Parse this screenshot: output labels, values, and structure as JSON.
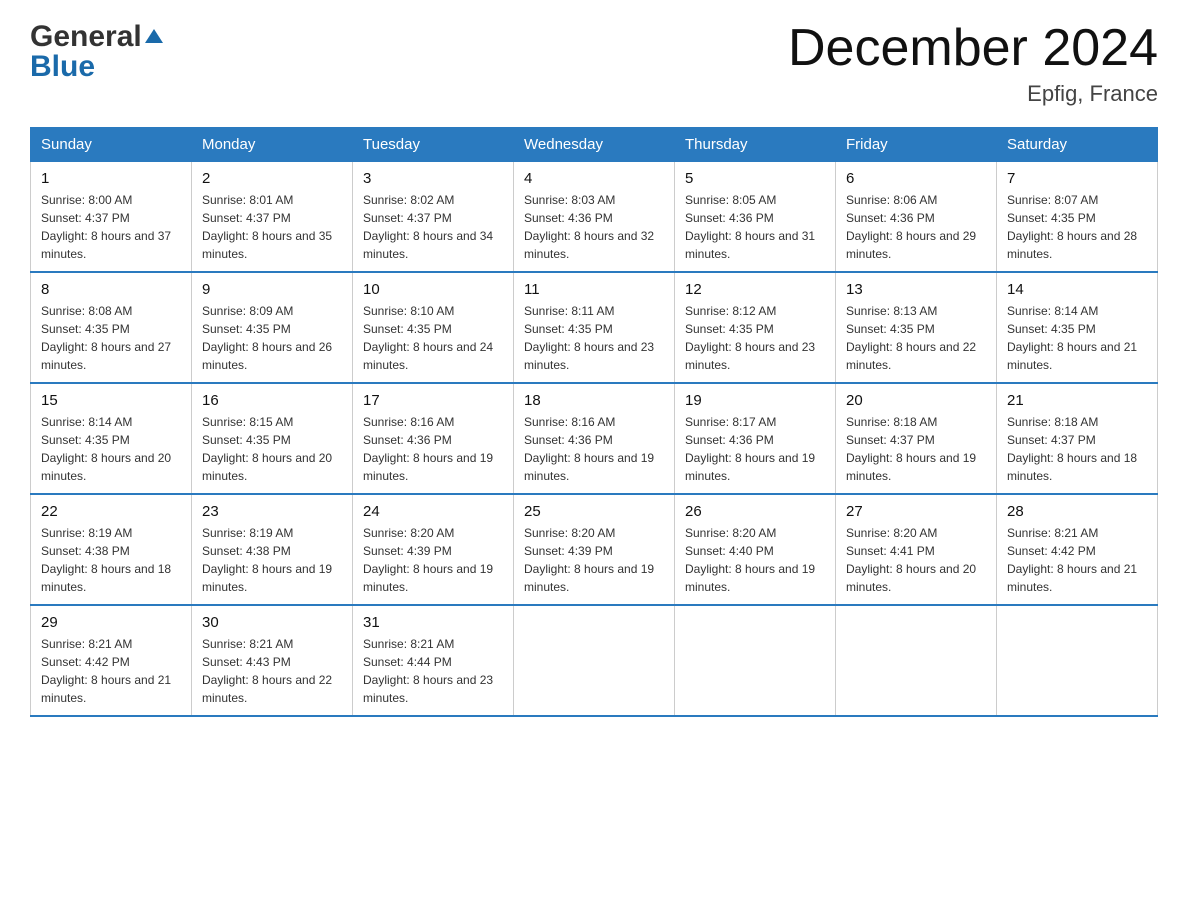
{
  "header": {
    "logo_line1": "General",
    "logo_line2": "Blue",
    "title": "December 2024",
    "subtitle": "Epfig, France"
  },
  "days_of_week": [
    "Sunday",
    "Monday",
    "Tuesday",
    "Wednesday",
    "Thursday",
    "Friday",
    "Saturday"
  ],
  "weeks": [
    [
      {
        "day": "1",
        "sunrise": "8:00 AM",
        "sunset": "4:37 PM",
        "daylight": "8 hours and 37 minutes."
      },
      {
        "day": "2",
        "sunrise": "8:01 AM",
        "sunset": "4:37 PM",
        "daylight": "8 hours and 35 minutes."
      },
      {
        "day": "3",
        "sunrise": "8:02 AM",
        "sunset": "4:37 PM",
        "daylight": "8 hours and 34 minutes."
      },
      {
        "day": "4",
        "sunrise": "8:03 AM",
        "sunset": "4:36 PM",
        "daylight": "8 hours and 32 minutes."
      },
      {
        "day": "5",
        "sunrise": "8:05 AM",
        "sunset": "4:36 PM",
        "daylight": "8 hours and 31 minutes."
      },
      {
        "day": "6",
        "sunrise": "8:06 AM",
        "sunset": "4:36 PM",
        "daylight": "8 hours and 29 minutes."
      },
      {
        "day": "7",
        "sunrise": "8:07 AM",
        "sunset": "4:35 PM",
        "daylight": "8 hours and 28 minutes."
      }
    ],
    [
      {
        "day": "8",
        "sunrise": "8:08 AM",
        "sunset": "4:35 PM",
        "daylight": "8 hours and 27 minutes."
      },
      {
        "day": "9",
        "sunrise": "8:09 AM",
        "sunset": "4:35 PM",
        "daylight": "8 hours and 26 minutes."
      },
      {
        "day": "10",
        "sunrise": "8:10 AM",
        "sunset": "4:35 PM",
        "daylight": "8 hours and 24 minutes."
      },
      {
        "day": "11",
        "sunrise": "8:11 AM",
        "sunset": "4:35 PM",
        "daylight": "8 hours and 23 minutes."
      },
      {
        "day": "12",
        "sunrise": "8:12 AM",
        "sunset": "4:35 PM",
        "daylight": "8 hours and 23 minutes."
      },
      {
        "day": "13",
        "sunrise": "8:13 AM",
        "sunset": "4:35 PM",
        "daylight": "8 hours and 22 minutes."
      },
      {
        "day": "14",
        "sunrise": "8:14 AM",
        "sunset": "4:35 PM",
        "daylight": "8 hours and 21 minutes."
      }
    ],
    [
      {
        "day": "15",
        "sunrise": "8:14 AM",
        "sunset": "4:35 PM",
        "daylight": "8 hours and 20 minutes."
      },
      {
        "day": "16",
        "sunrise": "8:15 AM",
        "sunset": "4:35 PM",
        "daylight": "8 hours and 20 minutes."
      },
      {
        "day": "17",
        "sunrise": "8:16 AM",
        "sunset": "4:36 PM",
        "daylight": "8 hours and 19 minutes."
      },
      {
        "day": "18",
        "sunrise": "8:16 AM",
        "sunset": "4:36 PM",
        "daylight": "8 hours and 19 minutes."
      },
      {
        "day": "19",
        "sunrise": "8:17 AM",
        "sunset": "4:36 PM",
        "daylight": "8 hours and 19 minutes."
      },
      {
        "day": "20",
        "sunrise": "8:18 AM",
        "sunset": "4:37 PM",
        "daylight": "8 hours and 19 minutes."
      },
      {
        "day": "21",
        "sunrise": "8:18 AM",
        "sunset": "4:37 PM",
        "daylight": "8 hours and 18 minutes."
      }
    ],
    [
      {
        "day": "22",
        "sunrise": "8:19 AM",
        "sunset": "4:38 PM",
        "daylight": "8 hours and 18 minutes."
      },
      {
        "day": "23",
        "sunrise": "8:19 AM",
        "sunset": "4:38 PM",
        "daylight": "8 hours and 19 minutes."
      },
      {
        "day": "24",
        "sunrise": "8:20 AM",
        "sunset": "4:39 PM",
        "daylight": "8 hours and 19 minutes."
      },
      {
        "day": "25",
        "sunrise": "8:20 AM",
        "sunset": "4:39 PM",
        "daylight": "8 hours and 19 minutes."
      },
      {
        "day": "26",
        "sunrise": "8:20 AM",
        "sunset": "4:40 PM",
        "daylight": "8 hours and 19 minutes."
      },
      {
        "day": "27",
        "sunrise": "8:20 AM",
        "sunset": "4:41 PM",
        "daylight": "8 hours and 20 minutes."
      },
      {
        "day": "28",
        "sunrise": "8:21 AM",
        "sunset": "4:42 PM",
        "daylight": "8 hours and 21 minutes."
      }
    ],
    [
      {
        "day": "29",
        "sunrise": "8:21 AM",
        "sunset": "4:42 PM",
        "daylight": "8 hours and 21 minutes."
      },
      {
        "day": "30",
        "sunrise": "8:21 AM",
        "sunset": "4:43 PM",
        "daylight": "8 hours and 22 minutes."
      },
      {
        "day": "31",
        "sunrise": "8:21 AM",
        "sunset": "4:44 PM",
        "daylight": "8 hours and 23 minutes."
      },
      null,
      null,
      null,
      null
    ]
  ],
  "labels": {
    "sunrise": "Sunrise:",
    "sunset": "Sunset:",
    "daylight": "Daylight:"
  },
  "colors": {
    "header_bg": "#2a7abf",
    "border_accent": "#2a7abf"
  }
}
